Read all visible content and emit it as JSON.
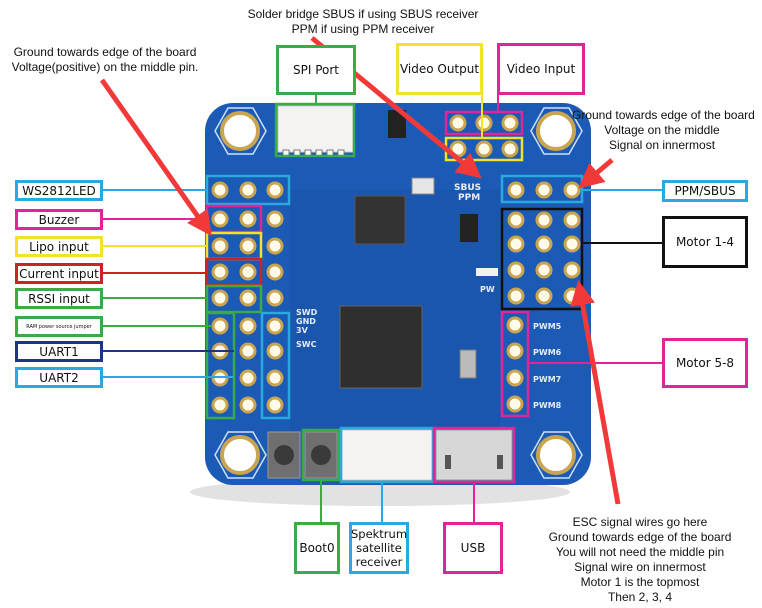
{
  "colors": {
    "board": "#1b5bb5",
    "board_dark": "#164c9c",
    "pad_ring": "#d9c27a",
    "arrow": "#f2393a",
    "green": "#3aab47",
    "blue": "#2aa9e0",
    "magenta": "#e0249a",
    "yellow": "#f2e22a",
    "red": "#cc2228",
    "navy": "#1d3585",
    "black": "#111111"
  },
  "notes": {
    "solder_bridge": [
      "Solder bridge SBUS if using SBUS receiver",
      "PPM if using PPM receiver"
    ],
    "left_power": [
      "Ground towards edge of the board",
      "Voltage(positive) on the middle pin."
    ],
    "right_ppm": [
      "Ground towards edge of the board",
      "Voltage on the middle",
      "Signal on innermost"
    ],
    "esc": [
      "ESC signal wires go here",
      "Ground towards edge of the board",
      "You will not need the middle pin",
      "Signal wire on innermost",
      "Motor 1 is the topmost",
      "Then 2, 3, 4"
    ]
  },
  "labels": {
    "spi_port": "SPI Port",
    "video_output": "Video Output",
    "video_input": "Video Input",
    "ws2812led": "WS2812LED",
    "buzzer": "Buzzer",
    "lipo_input": "Lipo input",
    "current_input": "Current input",
    "rssi_input": "RSSI input",
    "ram_jumper": "RAM power source jumper",
    "uart1": "UART1",
    "uart2": "UART2",
    "ppm_sbus": "PPM/SBUS",
    "motor_1_4": "Motor 1-4",
    "motor_5_8": "Motor 5-8",
    "boot0": "Boot0",
    "spektrum": "Spektrum satellite receiver",
    "usb": "USB"
  },
  "silkscreen": {
    "sbus": "SBUS",
    "ppm": "PPM",
    "pw": "PW",
    "swd": "SWD",
    "gnd": "GND",
    "v3": "3V",
    "swc": "SWC",
    "pwm5": "PWM5",
    "pwm6": "PWM6",
    "pwm7": "PWM7",
    "pwm8": "PWM8"
  }
}
